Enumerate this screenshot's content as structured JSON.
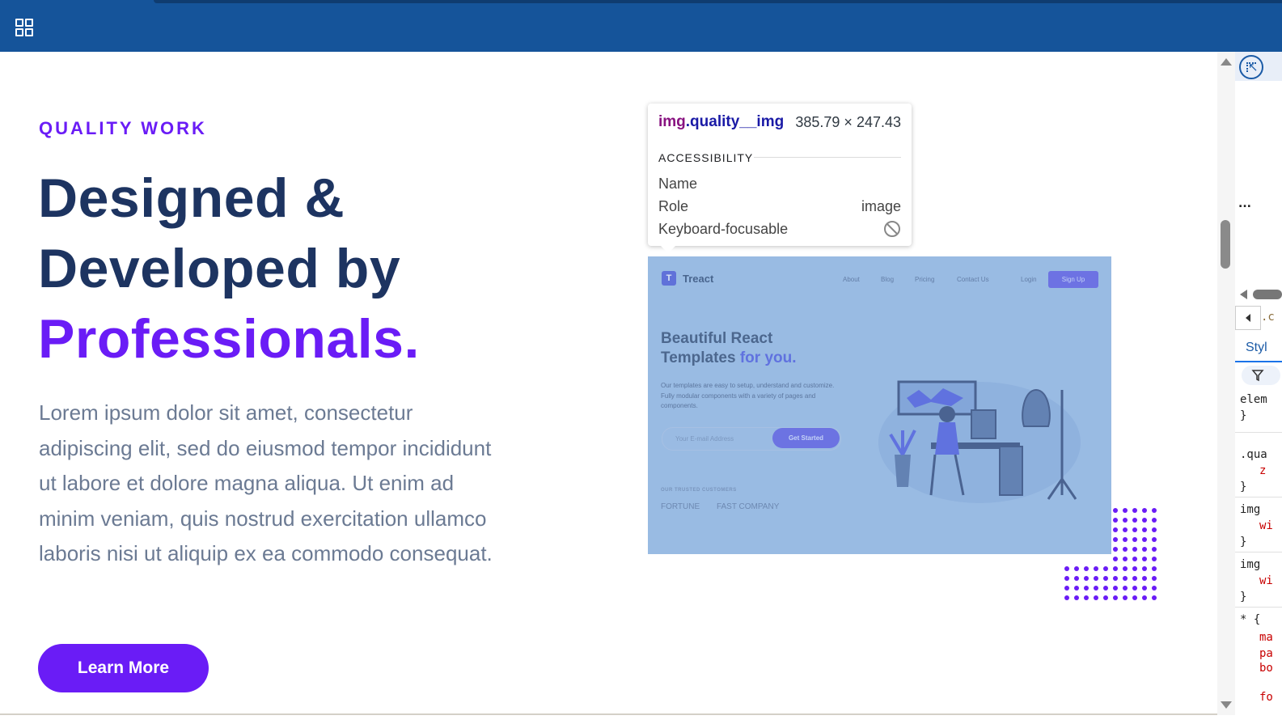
{
  "browser": {
    "apps_icon": "grid-apps-icon"
  },
  "hero": {
    "eyebrow": "QUALITY WORK",
    "headline_line1": "Designed &",
    "headline_line2": "Developed by",
    "headline_accent": "Professionals.",
    "lead": "Lorem ipsum dolor sit amet, consectetur adipiscing elit, sed do eiusmod tempor incididunt ut labore et dolore magna aliqua. Ut enim ad minim veniam, quis nostrud exercitation ullamco laboris nisi ut aliquip ex ea commodo consequat.",
    "button": "Learn More"
  },
  "mockup": {
    "logo_letter": "T",
    "brand": "Treact",
    "nav": [
      "About",
      "Blog",
      "Pricing",
      "Contact Us",
      "Login"
    ],
    "signup": "Sign Up",
    "title_line1": "Beautiful React",
    "title_line2": "Templates",
    "title_highlight": "for you.",
    "text": "Our templates are easy to setup, understand and customize. Fully modular components with a variety of pages and components.",
    "email_placeholder": "Your E-mail Address",
    "cta": "Get Started",
    "trusted": "OUR TRUSTED CUSTOMERS",
    "logos": [
      "FORTUNE",
      "FAST COMPANY"
    ]
  },
  "tooltip": {
    "tag": "img",
    "class": ".quality__img",
    "size": "385.79 × 247.43",
    "section": "ACCESSIBILITY",
    "rows": [
      {
        "label": "Name",
        "value": ""
      },
      {
        "label": "Role",
        "value": "image"
      },
      {
        "label": "Keyboard-focusable",
        "value": ""
      }
    ]
  },
  "devtools": {
    "dots": "...",
    "styles_tab": "Styl",
    "lines": [
      ".c",
      "elem",
      "}",
      ".qua",
      "z",
      "}",
      "img",
      "wi",
      "}",
      "img",
      "wi",
      "}",
      "* {",
      "ma",
      "pa",
      "bo",
      "fo"
    ]
  },
  "colors": {
    "brand_blue": "#15549a",
    "accent_purple": "#6a1cf6",
    "heading": "#1d3461",
    "body_text": "#6b7a93"
  }
}
